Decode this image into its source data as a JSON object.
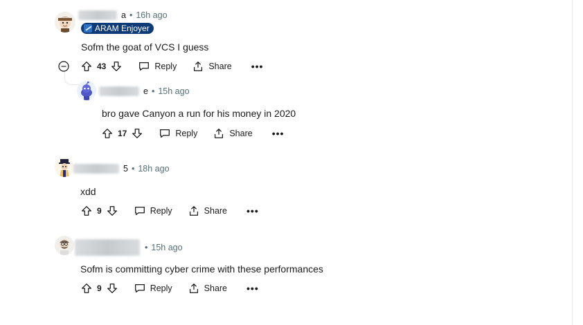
{
  "comments": [
    {
      "timestamp": "16h ago",
      "username_suffix": "a",
      "flair": "ARAM Enjoyer",
      "text": "Sofm the goat of VCS I guess",
      "votes": "43",
      "reply_label": "Reply",
      "share_label": "Share",
      "more_label": "•••"
    },
    {
      "timestamp": "15h ago",
      "username_suffix": "e",
      "text": "bro gave Canyon a run for his money in 2020",
      "votes": "17",
      "reply_label": "Reply",
      "share_label": "Share",
      "more_label": "•••"
    },
    {
      "timestamp": "18h ago",
      "username_suffix": "5",
      "text": "xdd",
      "votes": "9",
      "reply_label": "Reply",
      "share_label": "Share",
      "more_label": "•••"
    },
    {
      "timestamp": "15h ago",
      "username_suffix": "",
      "text": "Sofm is committing cyber crime with these performances",
      "votes": "9",
      "reply_label": "Reply",
      "share_label": "Share",
      "more_label": "•••"
    }
  ],
  "colors": {
    "flair_bg": "#0c3b75",
    "meta_text": "#576f76",
    "thread_line": "#e5e9eb"
  },
  "icons": [
    "upvote-icon",
    "downvote-icon",
    "reply-icon",
    "share-icon",
    "collapse-icon",
    "more-icon",
    "flair-icon"
  ]
}
